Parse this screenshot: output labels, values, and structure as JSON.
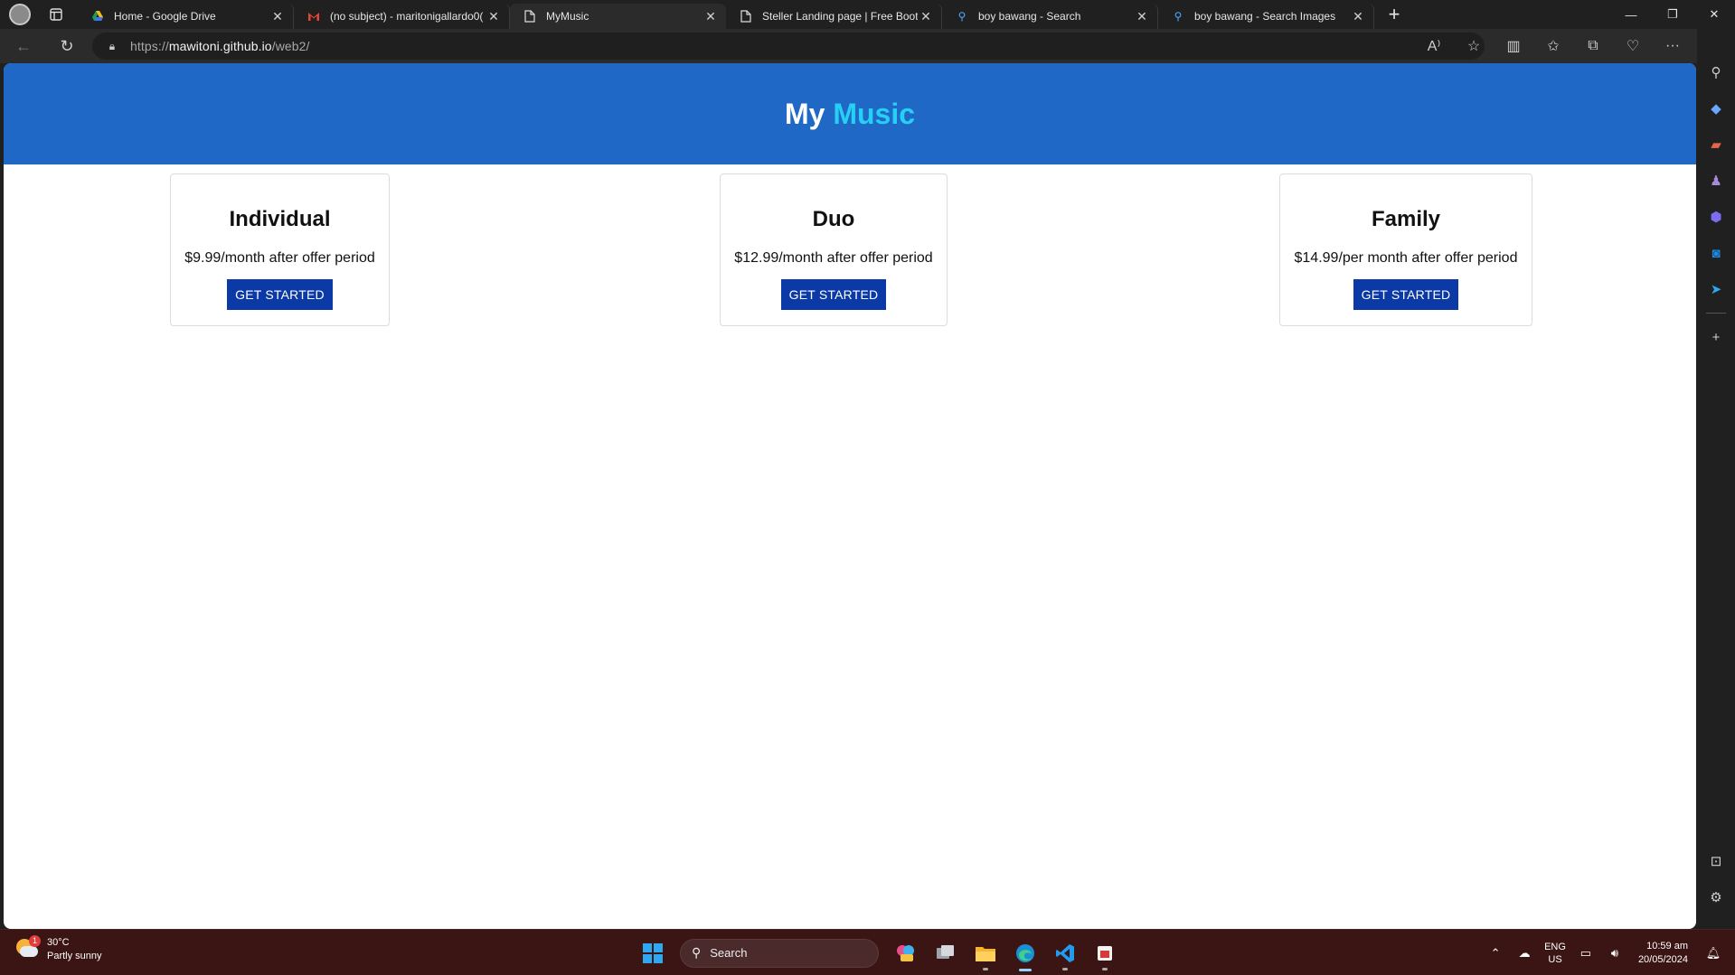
{
  "browser": {
    "tabs": [
      {
        "title": "Home - Google Drive",
        "icon": "google-drive-icon",
        "active": false
      },
      {
        "title": "(no subject) - maritonigallardo0(",
        "icon": "gmail-icon",
        "active": false
      },
      {
        "title": "MyMusic",
        "icon": "page-icon",
        "active": true
      },
      {
        "title": "Steller Landing page | Free Boots",
        "icon": "page-icon",
        "active": false
      },
      {
        "title": "boy bawang - Search",
        "icon": "search-icon",
        "active": false
      },
      {
        "title": "boy bawang - Search Images",
        "icon": "search-icon",
        "active": false
      }
    ],
    "url_prefix": "https://",
    "url_host": "mawitoni.github.io",
    "url_path": "/web2/"
  },
  "page": {
    "title_part1": "My",
    "title_part2": "Music",
    "accent_color": "#26d0f4",
    "header_color": "#1f68c5",
    "plans": [
      {
        "name": "Individual",
        "price": "$9.99/month after offer period",
        "cta": "GET STARTED"
      },
      {
        "name": "Duo",
        "price": "$12.99/month after offer period",
        "cta": "GET STARTED"
      },
      {
        "name": "Family",
        "price": "$14.99/per month after offer period",
        "cta": "GET STARTED"
      }
    ],
    "button_color": "#0b3aa6"
  },
  "taskbar": {
    "weather_temp": "30°C",
    "weather_desc": "Partly sunny",
    "weather_badge": "1",
    "search_placeholder": "Search",
    "lang_line1": "ENG",
    "lang_line2": "US",
    "time": "10:59 am",
    "date": "20/05/2024"
  }
}
